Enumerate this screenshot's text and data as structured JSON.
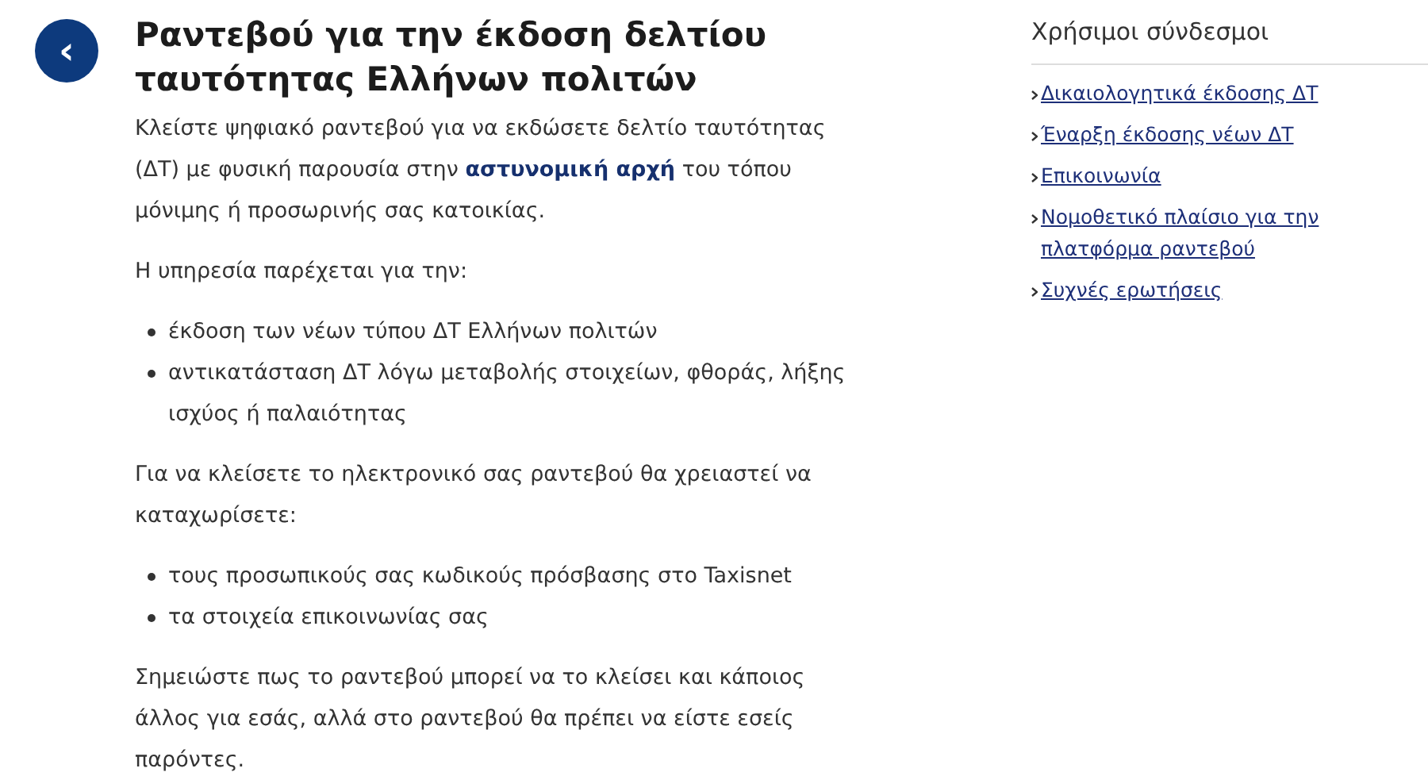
{
  "back_button": {
    "label": "‹"
  },
  "title": "Ραντεβού για την έκδοση δελτίου ταυτότητας Ελλήνων πολιτών",
  "content": [
    {
      "kind": "paragraph",
      "text": "Κλείστε ψηφιακό ραντεβού για να εκδώσετε δελτίο ταυτότητας (ΔΤ) με φυσική παρουσία στην **αστυνομική αρχή** του τόπου μόνιμης ή προσωρινής σας κατοικίας."
    },
    {
      "kind": "paragraph",
      "text": "Η υπηρεσία παρέχεται για την:"
    },
    {
      "kind": "list",
      "items": [
        "έκδοση των νέων τύπου ΔΤ Ελλήνων πολιτών",
        "αντικατάσταση ΔΤ λόγω μεταβολής στοιχείων, φθοράς, λήξης ισχύος ή παλαιότητας"
      ]
    },
    {
      "kind": "paragraph",
      "text": "Για να κλείσετε το ηλεκτρονικό σας ραντεβού θα χρειαστεί να καταχωρίσετε:"
    },
    {
      "kind": "list",
      "items": [
        "τους προσωπικούς σας κωδικούς πρόσβασης στο Taxisnet",
        "τα στοιχεία επικοινωνίας σας"
      ]
    },
    {
      "kind": "paragraph",
      "text": "Σημειώστε πως το ραντεβού μπορεί να το κλείσει και κάποιος άλλος για εσάς, αλλά στο ραντεβού θα πρέπει να είστε εσείς παρόντες."
    }
  ],
  "sidebar": {
    "heading": "Χρήσιμοι σύνδεσμοι",
    "links": [
      "Δικαιολογητικά έκδοσης ΔΤ",
      "Έναρξη έκδοσης νέων ΔΤ",
      "Επικοινωνία",
      "Νομοθετικό πλαίσιο για την πλατφόρμα ραντεβού",
      "Συχνές ερωτήσεις"
    ]
  }
}
